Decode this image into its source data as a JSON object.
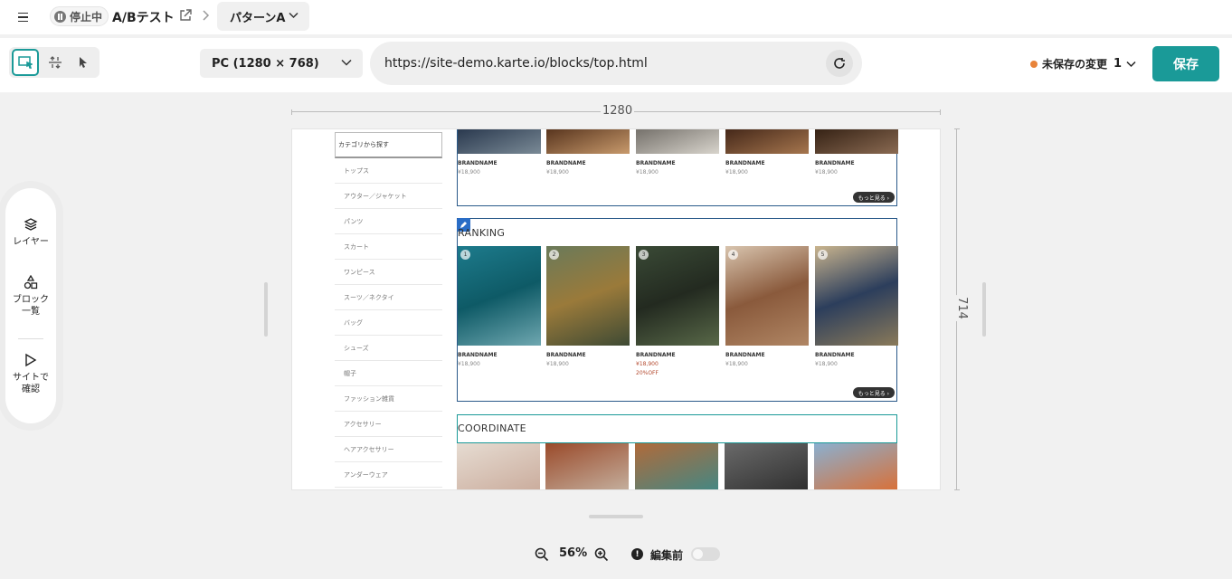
{
  "topbar": {
    "status": "停止中",
    "test_name": "A/Bテスト",
    "variant": "パターンA"
  },
  "toolbar": {
    "device": "PC (1280 × 768)",
    "url": "https://site-demo.karte.io/blocks/top.html",
    "unsaved_label": "未保存の変更",
    "unsaved_count": "1",
    "save_label": "保存"
  },
  "side_panel": {
    "layers": "レイヤー",
    "blocks_line1": "ブロック",
    "blocks_line2": "一覧",
    "preview_line1": "サイトで",
    "preview_line2": "確認"
  },
  "canvas": {
    "width_label": "1280",
    "height_label": "714"
  },
  "page": {
    "category_head": "カテゴリから探す",
    "categories": [
      "トップス",
      "アウター／ジャケット",
      "パンツ",
      "スカート",
      "ワンピース",
      "スーツ／ネクタイ",
      "バッグ",
      "シューズ",
      "帽子",
      "ファッション雑貨",
      "アクセサリー",
      "ヘアアクセサリー",
      "アンダーウェア"
    ],
    "more_label": "もっと見る ›",
    "top_products": [
      {
        "brand": "BRANDNAME",
        "price": "¥18,900"
      },
      {
        "brand": "BRANDNAME",
        "price": "¥18,900"
      },
      {
        "brand": "BRANDNAME",
        "price": "¥18,900"
      },
      {
        "brand": "BRANDNAME",
        "price": "¥18,900"
      },
      {
        "brand": "BRANDNAME",
        "price": "¥18,900"
      }
    ],
    "ranking_title": "RANKING",
    "ranking_products": [
      {
        "rank": "1",
        "brand": "BRANDNAME",
        "price": "¥18,900",
        "off": ""
      },
      {
        "rank": "2",
        "brand": "BRANDNAME",
        "price": "¥18,900",
        "off": ""
      },
      {
        "rank": "3",
        "brand": "BRANDNAME",
        "price": "¥18,900",
        "off": "20%OFF"
      },
      {
        "rank": "4",
        "brand": "BRANDNAME",
        "price": "¥18,900",
        "off": ""
      },
      {
        "rank": "5",
        "brand": "BRANDNAME",
        "price": "¥18,900",
        "off": ""
      }
    ],
    "coordinate_title": "COORDINATE"
  },
  "bottom": {
    "zoom": "56%",
    "edit_state": "編集前"
  },
  "colors": {
    "accent": "#1a9a98",
    "selected_block": "#2a5a8a",
    "unsaved_dot": "#e8833a",
    "sale": "#b3482d"
  }
}
